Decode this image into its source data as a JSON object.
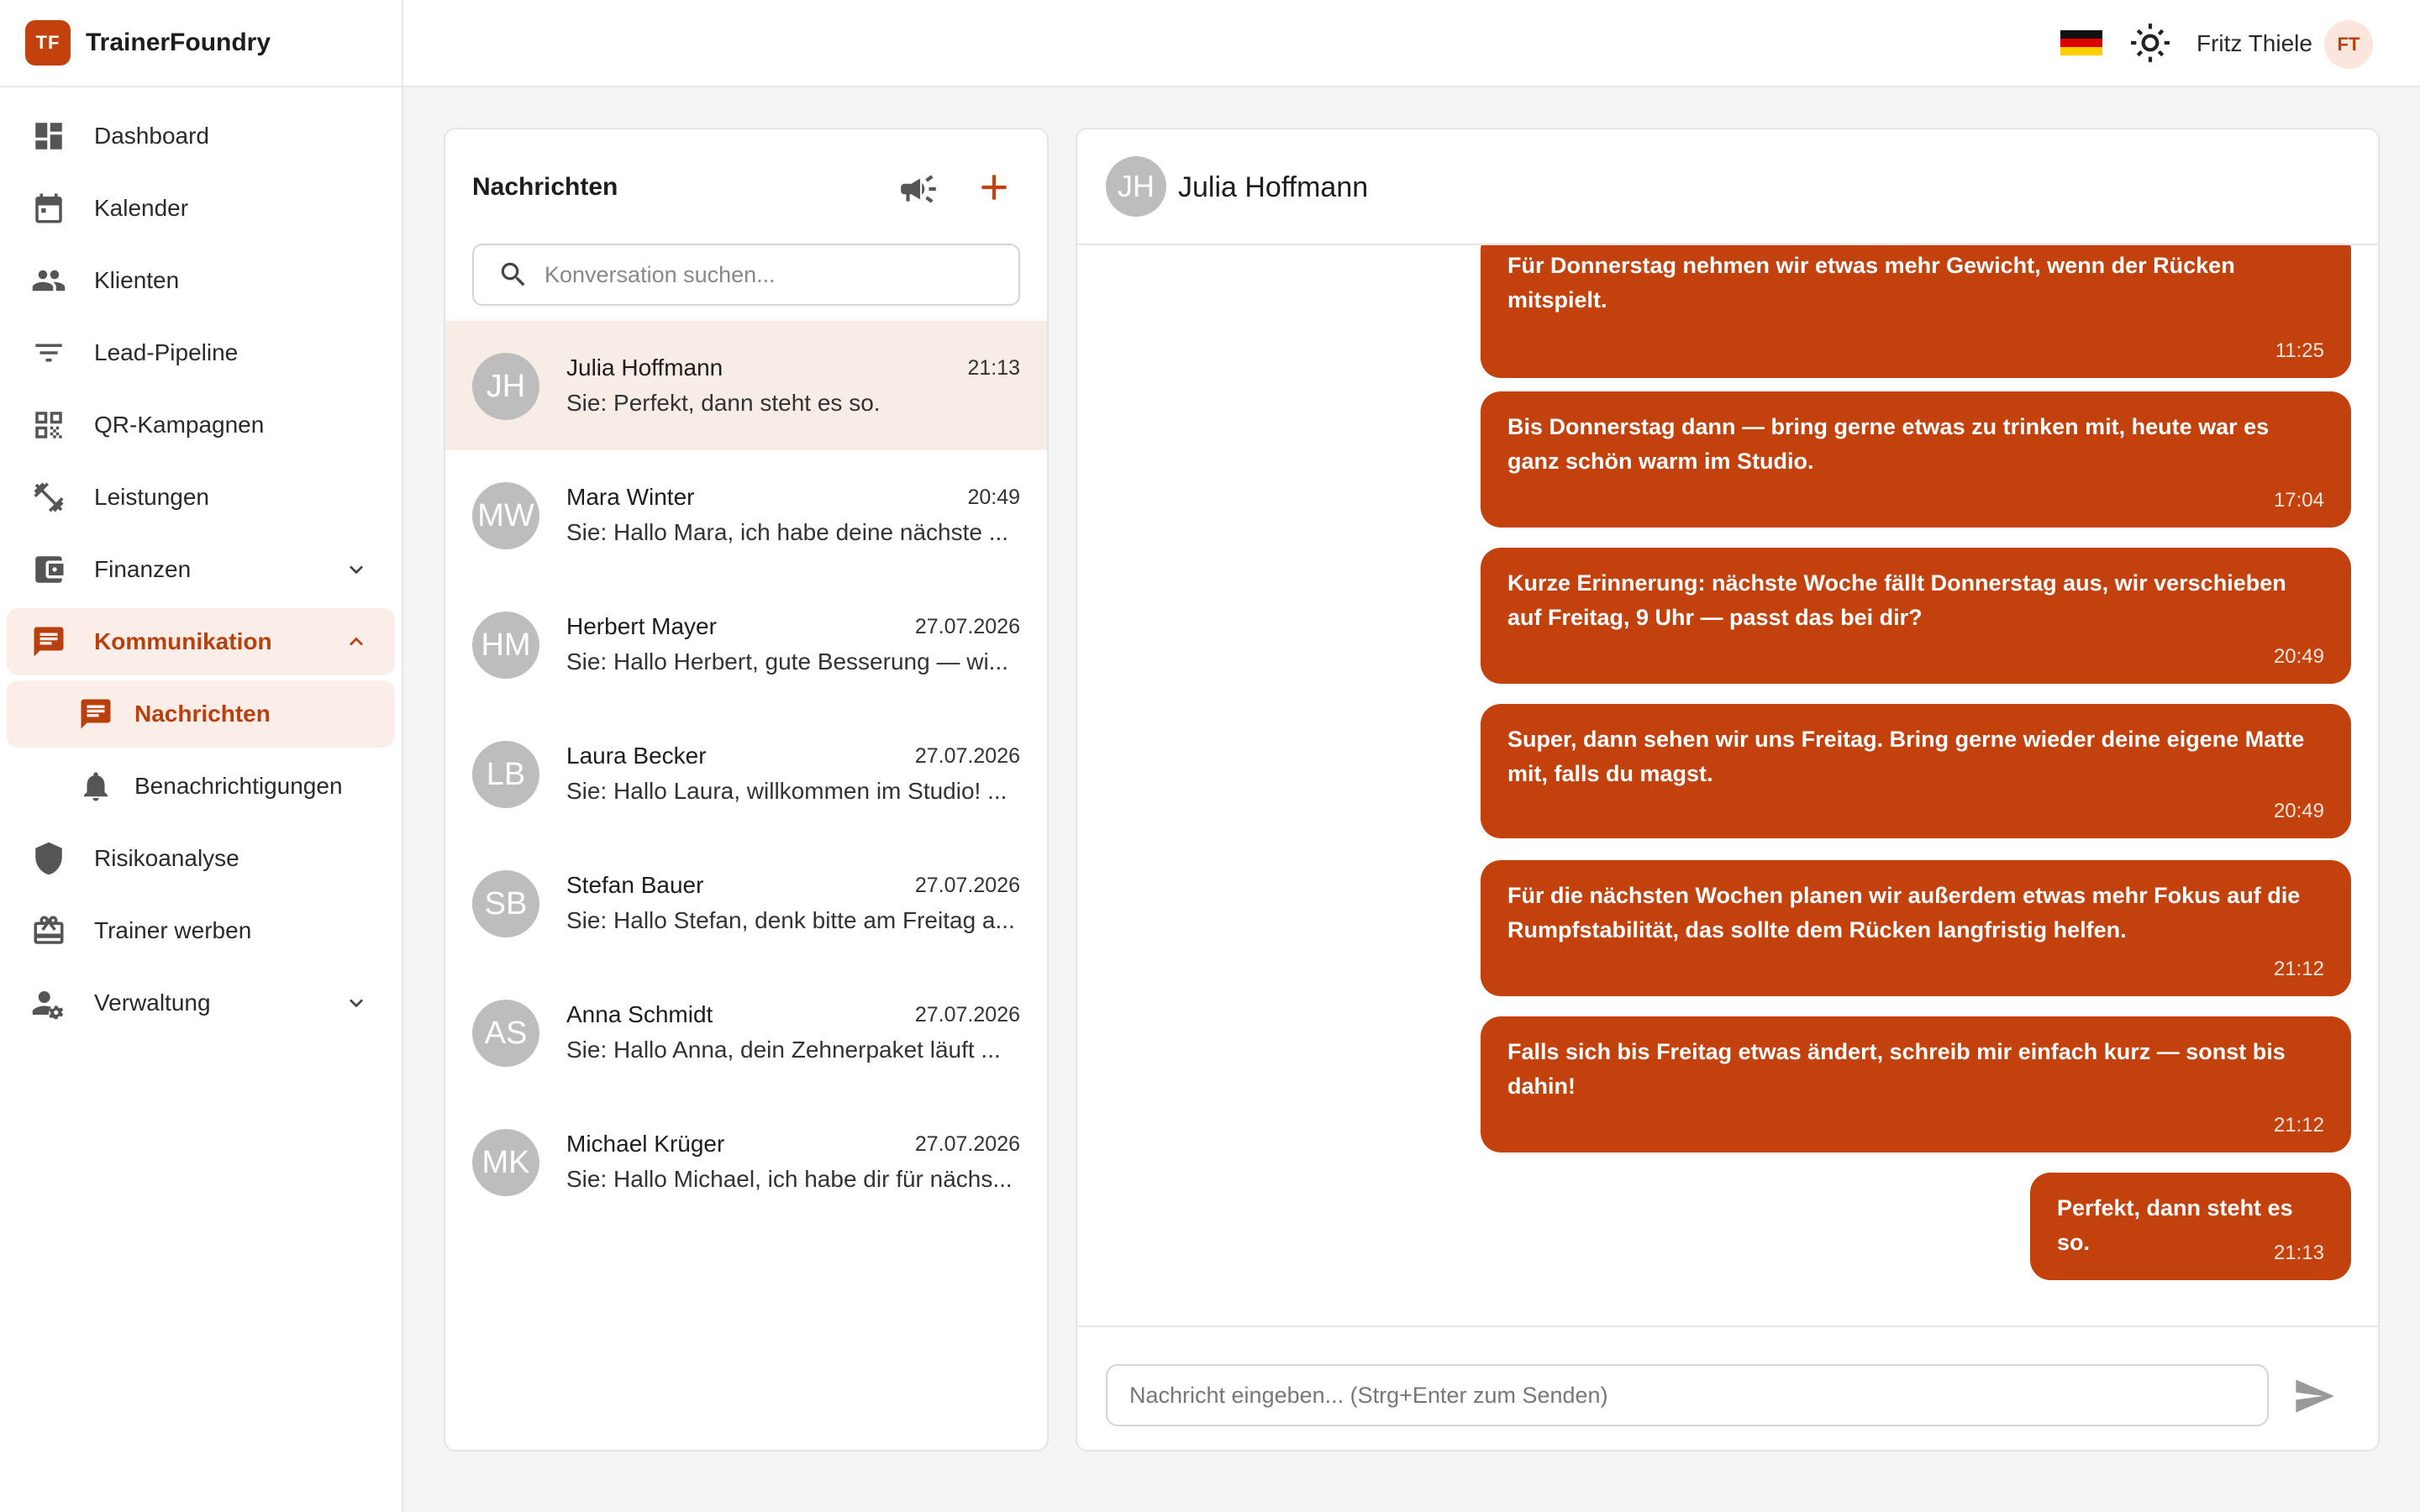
{
  "brand": {
    "logo_text": "TF",
    "name": "TrainerFoundry"
  },
  "sidebar": {
    "items": [
      {
        "label": "Dashboard",
        "icon": "dashboard-icon"
      },
      {
        "label": "Kalender",
        "icon": "calendar-icon"
      },
      {
        "label": "Klienten",
        "icon": "people-icon"
      },
      {
        "label": "Lead-Pipeline",
        "icon": "filter-icon"
      },
      {
        "label": "QR-Kampagnen",
        "icon": "qr-code-icon"
      },
      {
        "label": "Leistungen",
        "icon": "dumbbell-icon"
      },
      {
        "label": "Finanzen",
        "icon": "wallet-icon"
      },
      {
        "label": "Kommunikation",
        "icon": "chat-icon"
      },
      {
        "label": "Nachrichten",
        "icon": "message-icon"
      },
      {
        "label": "Benachrichtigungen",
        "icon": "bell-icon"
      },
      {
        "label": "Risikoanalyse",
        "icon": "shield-icon"
      },
      {
        "label": "Trainer werben",
        "icon": "gift-icon"
      },
      {
        "label": "Verwaltung",
        "icon": "user-settings-icon"
      }
    ]
  },
  "topbar": {
    "user_name": "Fritz Thiele",
    "user_initials": "FT",
    "language_flag": "de-flag-icon",
    "theme_icon": "sun-icon"
  },
  "conversations": {
    "title": "Nachrichten",
    "search_placeholder": "Konversation suchen...",
    "items": [
      {
        "initials": "JH",
        "name": "Julia Hoffmann",
        "time": "21:13",
        "preview": "Sie: Perfekt, dann steht es so."
      },
      {
        "initials": "MW",
        "name": "Mara Winter",
        "time": "20:49",
        "preview": "Sie: Hallo Mara, ich habe deine nächste ..."
      },
      {
        "initials": "HM",
        "name": "Herbert Mayer",
        "time": "27.07.2026",
        "preview": "Sie: Hallo Herbert, gute Besserung — wi..."
      },
      {
        "initials": "LB",
        "name": "Laura Becker",
        "time": "27.07.2026",
        "preview": "Sie: Hallo Laura, willkommen im Studio! ..."
      },
      {
        "initials": "SB",
        "name": "Stefan Bauer",
        "time": "27.07.2026",
        "preview": "Sie: Hallo Stefan, denk bitte am Freitag a..."
      },
      {
        "initials": "AS",
        "name": "Anna Schmidt",
        "time": "27.07.2026",
        "preview": "Sie: Hallo Anna, dein Zehnerpaket läuft ..."
      },
      {
        "initials": "MK",
        "name": "Michael Krüger",
        "time": "27.07.2026",
        "preview": "Sie: Hallo Michael, ich habe dir für nächs..."
      }
    ]
  },
  "chat": {
    "contact_initials": "JH",
    "contact_name": "Julia Hoffmann",
    "messages": [
      {
        "text": "Für Donnerstag nehmen wir etwas mehr Gewicht, wenn der Rücken mitspielt.",
        "time": "11:25"
      },
      {
        "text": "Bis Donnerstag dann — bring gerne etwas zu trinken mit, heute war es ganz schön warm im Studio.",
        "time": "17:04"
      },
      {
        "text": "Kurze Erinnerung: nächste Woche fällt Donnerstag aus, wir verschieben auf Freitag, 9 Uhr — passt das bei dir?",
        "time": "20:49"
      },
      {
        "text": "Super, dann sehen wir uns Freitag. Bring gerne wieder deine eigene Matte mit, falls du magst.",
        "time": "20:49"
      },
      {
        "text": "Für die nächsten Wochen planen wir außerdem etwas mehr Fokus auf die Rumpfstabilität, das sollte dem Rücken langfristig helfen.",
        "time": "21:12"
      },
      {
        "text": "Falls sich bis Freitag etwas ändert, schreib mir einfach kurz — sonst bis dahin!",
        "time": "21:12"
      },
      {
        "text": "Perfekt, dann steht es so.",
        "time": "21:13"
      }
    ],
    "composer_placeholder": "Nachricht eingeben... (Strg+Enter zum Senden)"
  },
  "colors": {
    "accent": "#c2410c",
    "accent_light": "#fbeee8",
    "avatar_gray": "#bdbdbd"
  }
}
